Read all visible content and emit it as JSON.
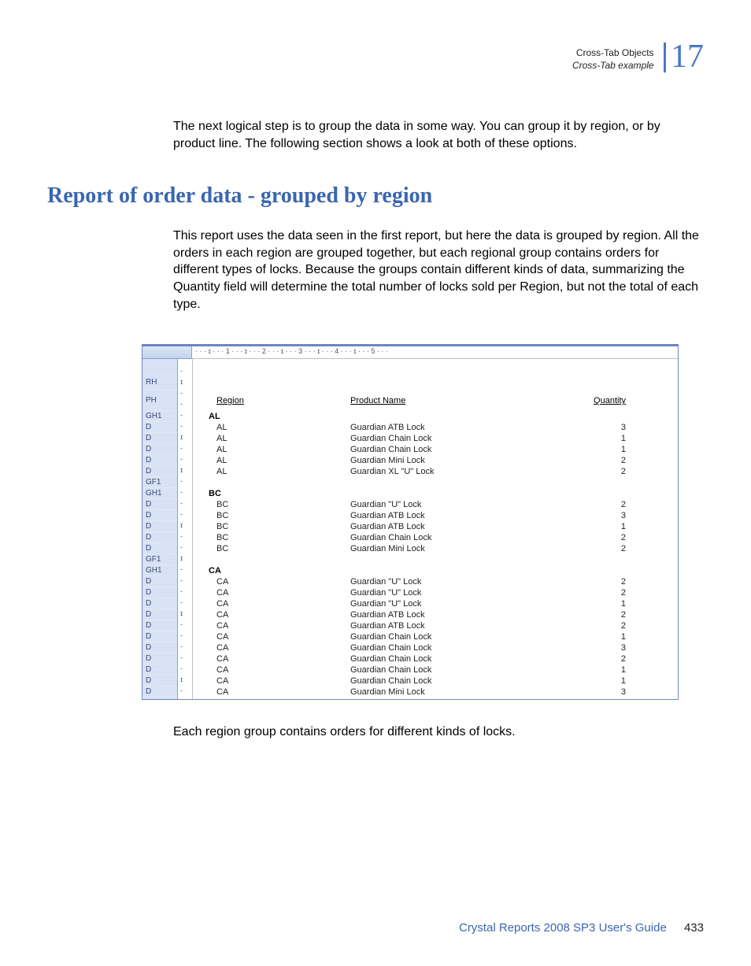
{
  "header": {
    "title": "Cross-Tab Objects",
    "subtitle": "Cross-Tab example",
    "chapter": "17"
  },
  "intro_paragraph": "The next logical step is to group the data in some way. You can group it by region, or by product line. The following section shows a look at both of these options.",
  "section_heading": "Report of order data - grouped by region",
  "body_paragraph": "This report uses the data seen in the first report, but here the data is grouped by region. All the orders in each region are grouped together, but each regional group contains orders for different types of locks. Because the groups contain different kinds of data, summarizing the Quantity field will determine the total number of locks sold per Region, but not the total of each type.",
  "caption": "Each region group contains orders for different kinds of locks.",
  "report": {
    "ruler": "·   ·   ·   ɪ   ·   ·   · 1 ·   ·   ·   ɪ   ·   ·   · 2 ·   ·   ·   ɪ   ·   ·   · 3 ·   ·   ·   ɪ   ·   ·   · 4 ·   ·   ·   ɪ   ·   ·   · 5 ·   ·   ·",
    "columns": {
      "region": "Region",
      "product": "Product Name",
      "quantity": "Quantity"
    },
    "section_labels": {
      "rh": "RH",
      "ph": "PH",
      "gh1": "GH1",
      "d": "D",
      "gf1": "GF1"
    },
    "groups": [
      {
        "name": "AL",
        "rows": [
          {
            "region": "AL",
            "product": "Guardian ATB Lock",
            "qty": "3"
          },
          {
            "region": "AL",
            "product": "Guardian Chain Lock",
            "qty": "1"
          },
          {
            "region": "AL",
            "product": "Guardian Chain Lock",
            "qty": "1"
          },
          {
            "region": "AL",
            "product": "Guardian Mini Lock",
            "qty": "2"
          },
          {
            "region": "AL",
            "product": "Guardian XL \"U\" Lock",
            "qty": "2"
          }
        ]
      },
      {
        "name": "BC",
        "rows": [
          {
            "region": "BC",
            "product": "Guardian \"U\" Lock",
            "qty": "2"
          },
          {
            "region": "BC",
            "product": "Guardian ATB Lock",
            "qty": "3"
          },
          {
            "region": "BC",
            "product": "Guardian ATB Lock",
            "qty": "1"
          },
          {
            "region": "BC",
            "product": "Guardian Chain Lock",
            "qty": "2"
          },
          {
            "region": "BC",
            "product": "Guardian Mini Lock",
            "qty": "2"
          }
        ]
      },
      {
        "name": "CA",
        "rows": [
          {
            "region": "CA",
            "product": "Guardian \"U\" Lock",
            "qty": "2"
          },
          {
            "region": "CA",
            "product": "Guardian \"U\" Lock",
            "qty": "2"
          },
          {
            "region": "CA",
            "product": "Guardian \"U\" Lock",
            "qty": "1"
          },
          {
            "region": "CA",
            "product": "Guardian ATB Lock",
            "qty": "2"
          },
          {
            "region": "CA",
            "product": "Guardian ATB Lock",
            "qty": "2"
          },
          {
            "region": "CA",
            "product": "Guardian Chain Lock",
            "qty": "1"
          },
          {
            "region": "CA",
            "product": "Guardian Chain Lock",
            "qty": "3"
          },
          {
            "region": "CA",
            "product": "Guardian Chain Lock",
            "qty": "2"
          },
          {
            "region": "CA",
            "product": "Guardian Chain Lock",
            "qty": "1"
          },
          {
            "region": "CA",
            "product": "Guardian Chain Lock",
            "qty": "1"
          },
          {
            "region": "CA",
            "product": "Guardian Mini Lock",
            "qty": "3"
          }
        ]
      }
    ]
  },
  "footer": {
    "guide": "Crystal Reports 2008 SP3 User's Guide",
    "page": "433"
  },
  "vruler_ticks": [
    "-",
    "ɪ",
    "-",
    "-",
    "-",
    "-",
    "ɪ",
    "-",
    "-",
    "ɪ",
    "-",
    "-",
    "-",
    "-",
    "ɪ",
    "-",
    "-",
    "ɪ",
    "-",
    "-",
    "-",
    "-",
    "ɪ",
    "-",
    "-",
    "-",
    "-",
    "-",
    "ɪ",
    "-"
  ]
}
